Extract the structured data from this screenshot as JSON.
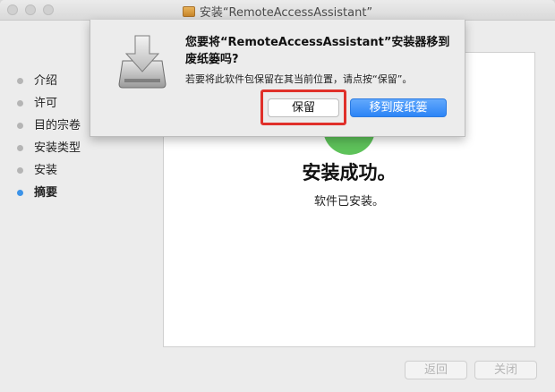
{
  "window": {
    "title": "安装“RemoteAccessAssistant”"
  },
  "sidebar": {
    "items": [
      {
        "label": "介绍",
        "active": false
      },
      {
        "label": "许可",
        "active": false
      },
      {
        "label": "目的宗卷",
        "active": false
      },
      {
        "label": "安装类型",
        "active": false
      },
      {
        "label": "安装",
        "active": false
      },
      {
        "label": "摘要",
        "active": true
      }
    ]
  },
  "main": {
    "success_title": "安装成功。",
    "success_subtitle": "软件已安装。"
  },
  "footer": {
    "back_label": "返回",
    "close_label": "关闭"
  },
  "dialog": {
    "title": "您要将“RemoteAccessAssistant”安装器移到废纸篓吗?",
    "message": "若要将此软件包保留在其当前位置，请点按“保留”。",
    "keep_label": "保留",
    "trash_label": "移到废纸篓"
  },
  "colors": {
    "accent": "#2c84f6",
    "highlight": "#e0302a",
    "success": "#5ec25a"
  }
}
